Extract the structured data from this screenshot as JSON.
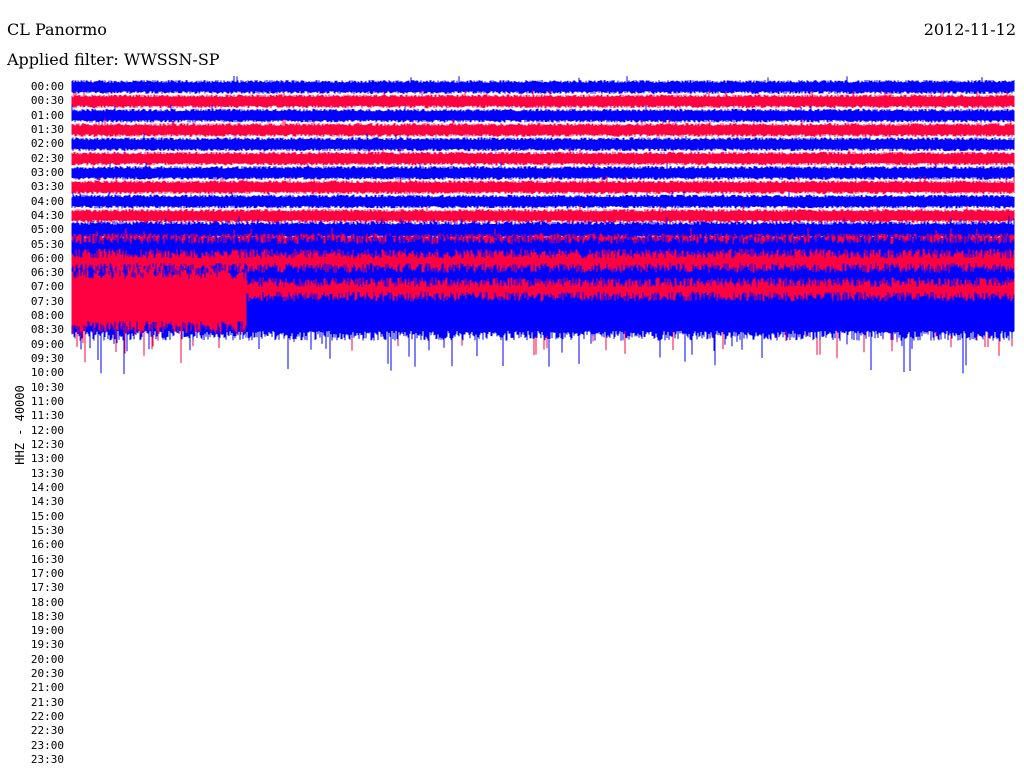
{
  "header": {
    "station": "CL Panormo",
    "date": "2012-11-12",
    "filter": "Applied filter: WWSSN-SP"
  },
  "chart_data": {
    "type": "line",
    "title": "CL Panormo",
    "ylabel": "HHZ - 40000",
    "row_minutes": 30,
    "time_labels": [
      "00:00",
      "00:30",
      "01:00",
      "01:30",
      "02:00",
      "02:30",
      "03:00",
      "03:30",
      "04:00",
      "04:30",
      "05:00",
      "05:30",
      "06:00",
      "06:30",
      "07:00",
      "07:30",
      "08:00",
      "08:30",
      "09:00",
      "09:30",
      "10:00",
      "10:30",
      "11:00",
      "11:30",
      "12:00",
      "12:30",
      "13:00",
      "13:30",
      "14:00",
      "14:30",
      "15:00",
      "15:30",
      "16:00",
      "16:30",
      "17:00",
      "17:30",
      "18:00",
      "18:30",
      "19:00",
      "19:30",
      "20:00",
      "20:30",
      "21:00",
      "21:30",
      "22:00",
      "22:30",
      "23:00",
      "23:30"
    ],
    "colors": [
      "#0000ff",
      "#ff0040"
    ],
    "rows_with_data": 18,
    "last_row_fraction": 0.185,
    "row_amplitude_relative": [
      1,
      1,
      1,
      1,
      1,
      1,
      1,
      1,
      1,
      1,
      1.3,
      1.6,
      3.5,
      3.5,
      3.5,
      3.5,
      3.5,
      5
    ]
  }
}
